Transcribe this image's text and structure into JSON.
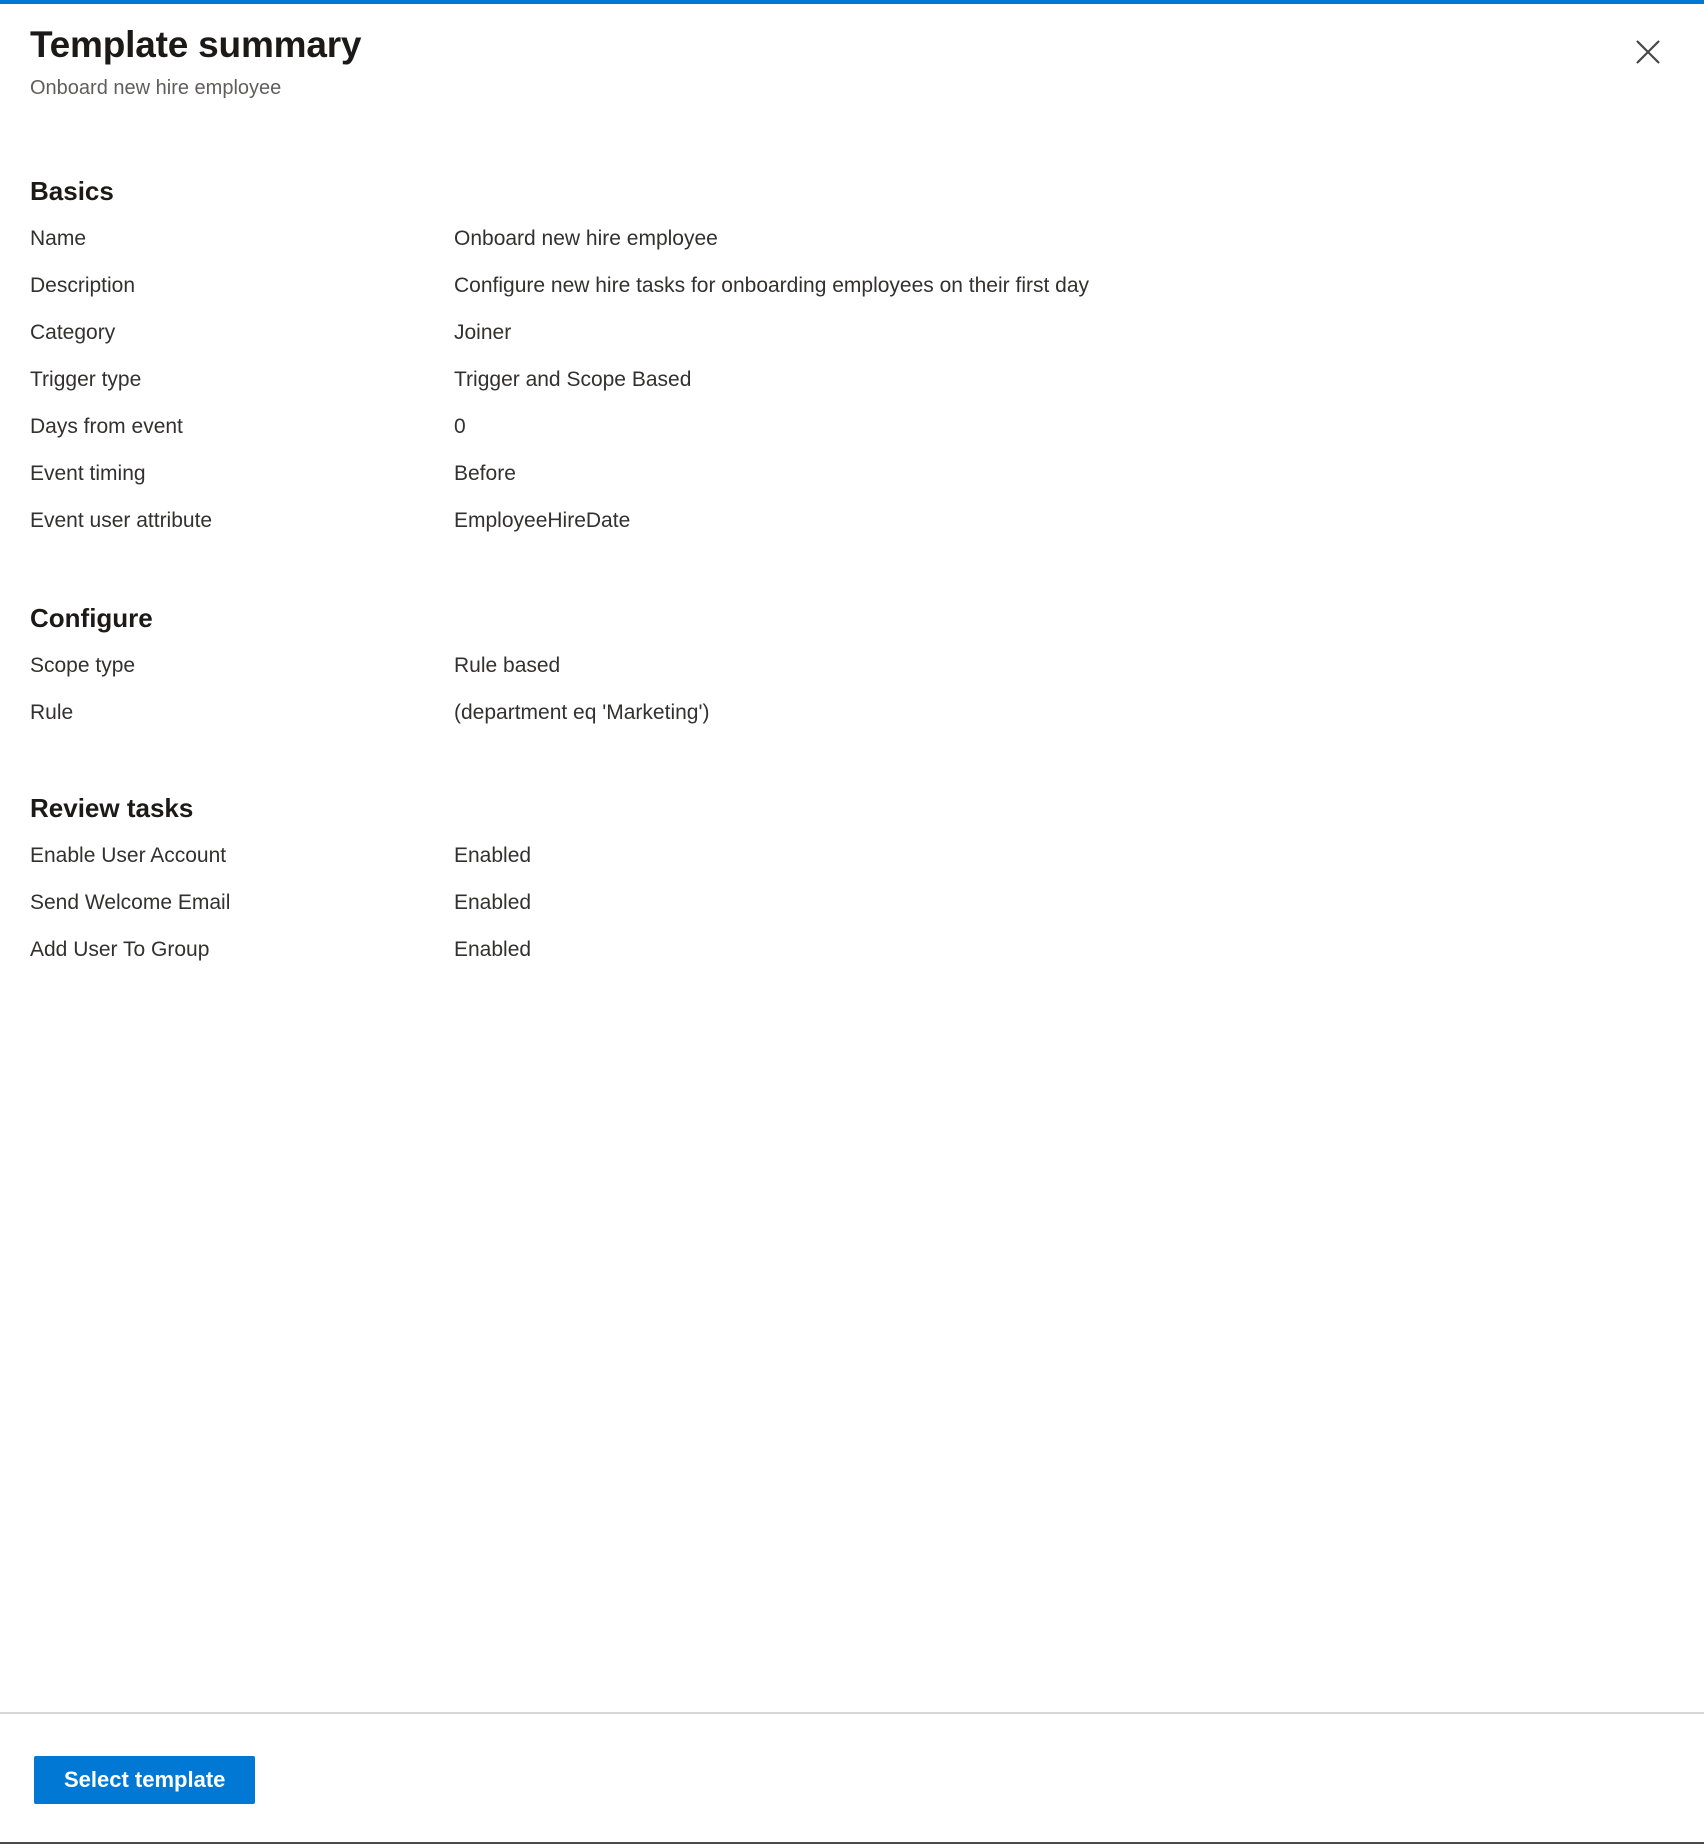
{
  "header": {
    "title": "Template summary",
    "subtitle": "Onboard new hire employee",
    "close_icon": "close-icon"
  },
  "sections": [
    {
      "heading": "Basics",
      "rows": [
        {
          "label": "Name",
          "value": "Onboard new hire employee"
        },
        {
          "label": "Description",
          "value": "Configure new hire tasks for onboarding employees on their first day"
        },
        {
          "label": "Category",
          "value": "Joiner"
        },
        {
          "label": "Trigger type",
          "value": "Trigger and Scope Based"
        },
        {
          "label": "Days from event",
          "value": "0"
        },
        {
          "label": "Event timing",
          "value": "Before"
        },
        {
          "label": "Event user attribute",
          "value": "EmployeeHireDate"
        }
      ]
    },
    {
      "heading": "Configure",
      "rows": [
        {
          "label": "Scope type",
          "value": "Rule based"
        },
        {
          "label": "Rule",
          "value": "(department eq 'Marketing')"
        }
      ]
    },
    {
      "heading": "Review tasks",
      "rows": [
        {
          "label": "Enable User Account",
          "value": "Enabled"
        },
        {
          "label": "Send Welcome Email",
          "value": "Enabled"
        },
        {
          "label": "Add User To Group",
          "value": "Enabled"
        }
      ]
    }
  ],
  "footer": {
    "select_template_label": "Select template"
  },
  "colors": {
    "accent": "#0078d4",
    "title": "#1b1a19",
    "text": "#323130",
    "subtitle": "#605e5c",
    "divider": "#d6d6d6"
  }
}
